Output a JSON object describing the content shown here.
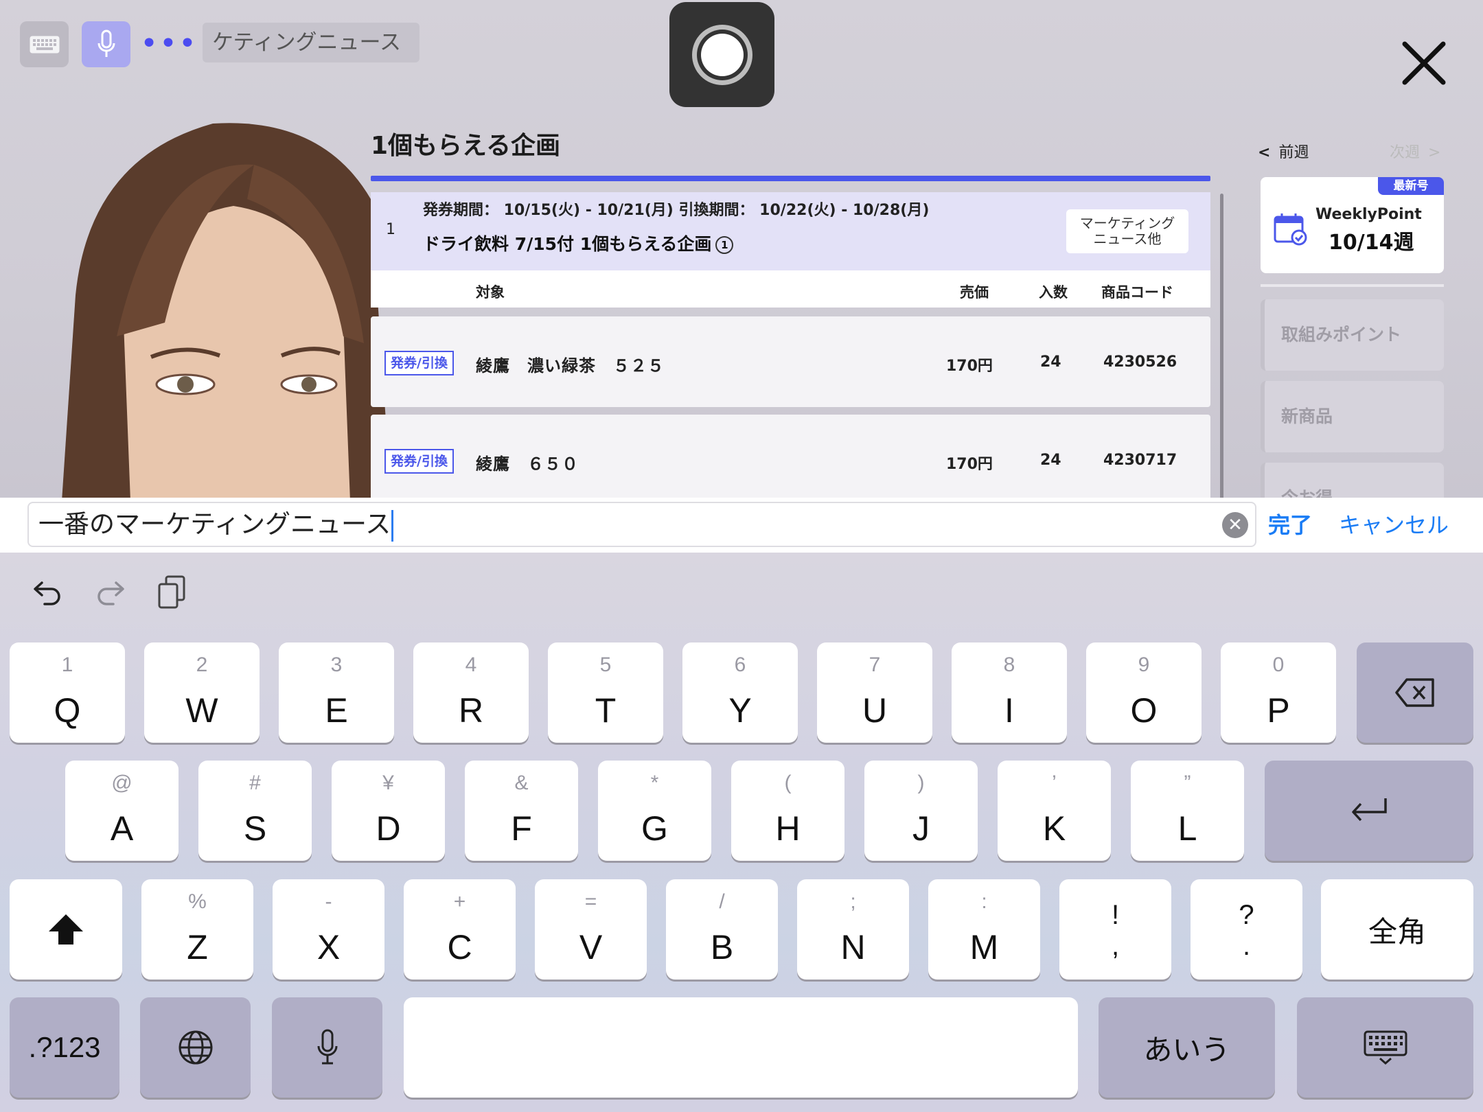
{
  "toolbar": {
    "suggestion": "ケティングニュース"
  },
  "campaign": {
    "title": "1個もらえる企画",
    "index": "1",
    "period": "発券期間： 10/15(火) - 10/21(月)  引換期間： 10/22(火) - 10/28(月)",
    "name": "ドライ飲料 7/15付 1個もらえる企画",
    "info_icon": "①",
    "tag_line1": "マーケティング",
    "tag_line2": "ニュース他",
    "columns": {
      "target": "対象",
      "price": "売価",
      "qty": "入数",
      "code": "商品コード"
    },
    "rows": [
      {
        "badge": "発券/引換",
        "name": "綾鷹　濃い緑茶　５２５",
        "price": "170円",
        "qty": "24",
        "code": "4230526"
      },
      {
        "badge": "発券/引換",
        "name": "綾鷹　６５０",
        "price": "170円",
        "qty": "24",
        "code": "4230717"
      }
    ]
  },
  "sidebar": {
    "prev_week": "前週",
    "next_week": "次週",
    "latest_badge": "最新号",
    "weekly_label": "WeeklyPoint",
    "weekly_date": "10/14週",
    "items": [
      "取組みポイント",
      "新商品",
      "今お得"
    ]
  },
  "input": {
    "value": "一番のマーケティングニュース",
    "clear_icon": "✕",
    "done": "完了",
    "cancel": "キャンセル"
  },
  "keyboard": {
    "row1": [
      {
        "hint": "1",
        "key": "Q"
      },
      {
        "hint": "2",
        "key": "W"
      },
      {
        "hint": "3",
        "key": "E"
      },
      {
        "hint": "4",
        "key": "R"
      },
      {
        "hint": "5",
        "key": "T"
      },
      {
        "hint": "6",
        "key": "Y"
      },
      {
        "hint": "7",
        "key": "U"
      },
      {
        "hint": "8",
        "key": "I"
      },
      {
        "hint": "9",
        "key": "O"
      },
      {
        "hint": "0",
        "key": "P"
      }
    ],
    "row2": [
      {
        "hint": "@",
        "key": "A"
      },
      {
        "hint": "#",
        "key": "S"
      },
      {
        "hint": "¥",
        "key": "D"
      },
      {
        "hint": "&",
        "key": "F"
      },
      {
        "hint": "*",
        "key": "G"
      },
      {
        "hint": "(",
        "key": "H"
      },
      {
        "hint": ")",
        "key": "J"
      },
      {
        "hint": "’",
        "key": "K"
      },
      {
        "hint": "”",
        "key": "L"
      }
    ],
    "row3": [
      {
        "hint": "%",
        "key": "Z"
      },
      {
        "hint": "-",
        "key": "X"
      },
      {
        "hint": "+",
        "key": "C"
      },
      {
        "hint": "=",
        "key": "V"
      },
      {
        "hint": "/",
        "key": "B"
      },
      {
        "hint": ";",
        "key": "N"
      },
      {
        "hint": ":",
        "key": "M"
      },
      {
        "hint": "!",
        "key": ","
      },
      {
        "hint": "?",
        "key": "."
      }
    ],
    "zenkaku": "全角",
    "numbers": ".?123",
    "kana": "あいう",
    "icons": {
      "undo": "undo-icon",
      "redo": "redo-icon",
      "paste": "clipboard-icon",
      "delete": "backspace-icon",
      "return": "return-icon",
      "shift": "shift-icon",
      "globe": "globe-icon",
      "mic": "microphone-icon",
      "dismiss": "keyboard-dismiss-icon"
    }
  }
}
